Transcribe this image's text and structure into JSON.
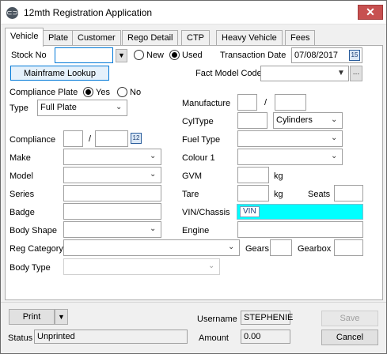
{
  "window": {
    "title": "12mth Registration Application",
    "icon": "car-icon",
    "close": "✕"
  },
  "tabs": [
    "Vehicle",
    "Plate",
    "Customer",
    "Rego Detail",
    "CTP",
    "Heavy Vehicle",
    "Fees"
  ],
  "stock": {
    "label": "Stock No",
    "value": "",
    "new_label": "New",
    "used_label": "Used",
    "selected": "Used",
    "transaction_date_label": "Transaction Date",
    "transaction_date": "07/08/2017",
    "mainframe_lookup": "Mainframe Lookup",
    "fact_model_code_label": "Fact Model Code",
    "fact_model_code": ""
  },
  "compliance_plate": {
    "label": "Compliance Plate",
    "yes_label": "Yes",
    "no_label": "No",
    "selected": "Yes"
  },
  "left_fields": {
    "type_label": "Type",
    "type_value": "Full Plate",
    "compliance_label": "Compliance",
    "compliance_separator": "/",
    "compliance_month": "",
    "compliance_year": "",
    "make_label": "Make",
    "make_value": "",
    "model_label": "Model",
    "model_value": "",
    "series_label": "Series",
    "series_value": "",
    "badge_label": "Badge",
    "badge_value": "",
    "body_shape_label": "Body Shape",
    "body_shape_value": "",
    "reg_category_label": "Reg Category",
    "reg_category_value": "",
    "body_type_label": "Body Type",
    "body_type_value": ""
  },
  "right_fields": {
    "manufacture_label": "Manufacture",
    "manufacture_separator": "/",
    "manufacture_month": "",
    "manufacture_year": "",
    "cyltype_label": "CylType",
    "cyltype_value": "",
    "cylinders_value": "Cylinders",
    "fuel_type_label": "Fuel Type",
    "fuel_type_value": "",
    "colour_label": "Colour 1",
    "colour_value": "",
    "gvm_label": "GVM",
    "gvm_value": "",
    "gvm_unit": "kg",
    "tare_label": "Tare",
    "tare_value": "",
    "tare_unit": "kg",
    "seats_label": "Seats",
    "seats_value": "",
    "vin_label": "VIN/Chassis",
    "vin_tag": "VIN",
    "vin_value": "",
    "engine_label": "Engine",
    "engine_value": "",
    "gears_label": "Gears",
    "gears_value": "",
    "gearbox_label": "Gearbox",
    "gearbox_value": ""
  },
  "footer": {
    "print_label": "Print",
    "username_label": "Username",
    "username_value": "STEPHENIE",
    "save_label": "Save",
    "status_label": "Status",
    "status_value": "Unprinted",
    "amount_label": "Amount",
    "amount_value": "0.00",
    "cancel_label": "Cancel"
  },
  "colors": {
    "vin_highlight": "#00ffff",
    "close_button": "#c75050",
    "focus_blue": "#0078d7"
  }
}
